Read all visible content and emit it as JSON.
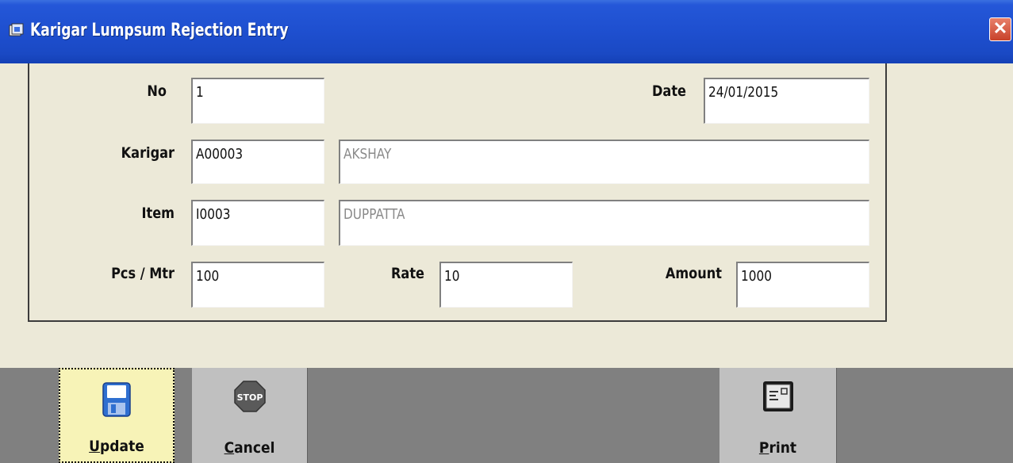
{
  "window": {
    "title": "Karigar Lumpsum Rejection Entry",
    "close_glyph": "✕"
  },
  "form": {
    "no": {
      "label": "No",
      "value": "1"
    },
    "date": {
      "label": "Date",
      "value": "24/01/2015"
    },
    "karigar": {
      "label": "Karigar",
      "code": "A00003",
      "name": "AKSHAY"
    },
    "item": {
      "label": "Item",
      "code": "I0003",
      "name": "DUPPATTA"
    },
    "pcs_mtr": {
      "label": "Pcs / Mtr",
      "value": "100"
    },
    "rate": {
      "label": "Rate",
      "value": "10"
    },
    "amount": {
      "label": "Amount",
      "value": "1000"
    }
  },
  "toolbar": {
    "update": {
      "label": "Update",
      "accel": "U",
      "rest": "pdate",
      "icon": "floppy-disk-icon"
    },
    "cancel": {
      "label": "Cancel",
      "accel": "C",
      "rest": "ancel",
      "icon": "stop-sign-icon",
      "icon_text": "STOP"
    },
    "print": {
      "label": "Print",
      "accel": "P",
      "rest": "rint",
      "icon": "printer-icon"
    }
  },
  "colors": {
    "titlebar": "#1e4fcf",
    "active_button": "#f7f3b7",
    "toolbar_bg": "#808080",
    "button_bg": "#c0c0c0"
  }
}
